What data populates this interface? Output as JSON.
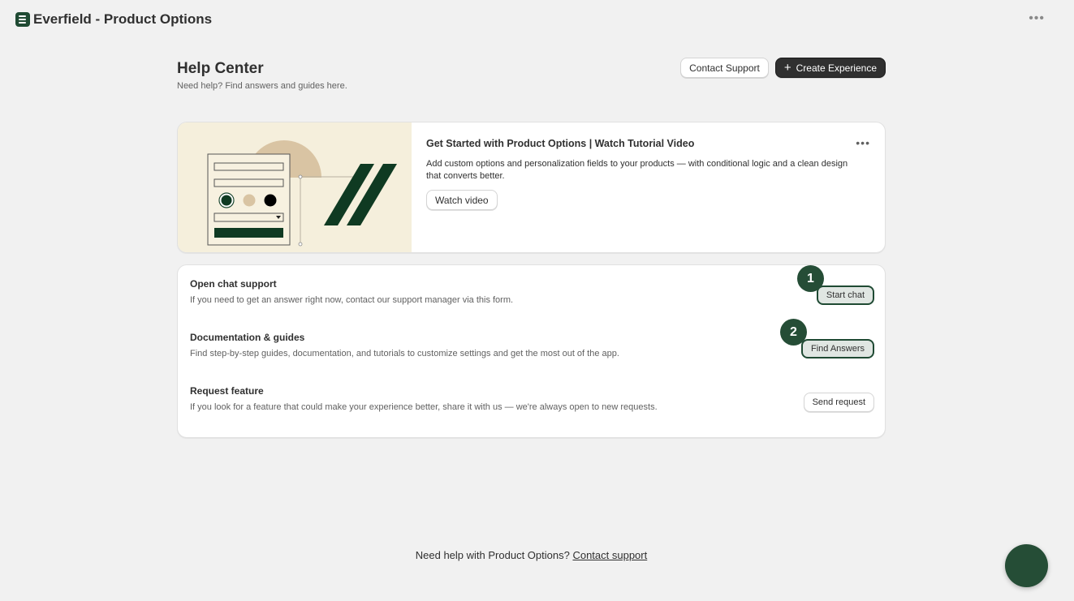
{
  "app": {
    "title": "Everfield - Product Options",
    "icon": "app-list-icon",
    "menu_icon": "more-horizontal-icon"
  },
  "header": {
    "title": "Help Center",
    "subtitle": "Need help? Find answers and guides here.",
    "contact_label": "Contact Support",
    "create_label": "Create Experience",
    "create_icon": "plus-icon"
  },
  "video": {
    "title": "Get Started with Product Options | Watch Tutorial Video",
    "description": "Add custom options and personalization fields to your products — with conditional logic and a clean design that converts better.",
    "button": "Watch video",
    "menu_icon": "more-horizontal-icon"
  },
  "support": [
    {
      "title": "Open chat support",
      "description": "If you need to get an answer right now, contact our support manager via this form.",
      "button": "Start chat",
      "badge": "1"
    },
    {
      "title": "Documentation & guides",
      "description": "Find step-by-step guides, documentation, and tutorials to customize settings and get the most out of the app.",
      "button": "Find Answers",
      "badge": "2"
    },
    {
      "title": "Request feature",
      "description": "If you look for a feature that could make your experience better, share it with us — we're always open to new requests.",
      "button": "Send request"
    }
  ],
  "footer": {
    "text": "Need help with Product Options?",
    "link": "Contact support"
  },
  "colors": {
    "brand": "#1f4a33",
    "badge": "#254d36",
    "illustration_bg": "#f5efdc",
    "accent_tan": "#d9c4a3",
    "page_bg": "#f1f1f1"
  }
}
